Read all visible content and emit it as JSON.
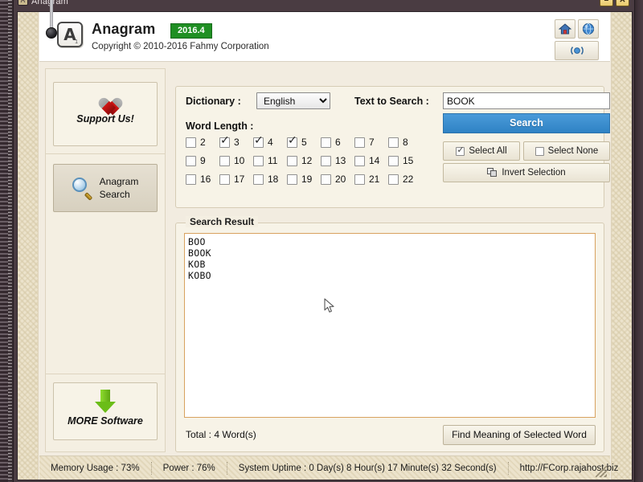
{
  "window": {
    "title": "Anagram",
    "icon": "app-icon",
    "minimize_label": "–",
    "maximize_label": "✕"
  },
  "header": {
    "logo_letter": "A",
    "logo_sub": "1",
    "app_name": "Anagram",
    "version": "2016.4",
    "version_color": "#1f8f23",
    "copyright": "Copyright © 2010-2016 Fahmy Corporation",
    "icons": [
      {
        "name": "home-icon",
        "glyph": "⌂"
      },
      {
        "name": "info-globe-icon",
        "glyph": "i"
      },
      {
        "name": "update-icon",
        "glyph": "(•)"
      }
    ]
  },
  "sidebar": {
    "support": {
      "label": "Support Us!",
      "icon": "heart-icon"
    },
    "anagram": {
      "label_line1": "Anagram",
      "label_line2": "Search",
      "icon": "magnifier-icon"
    },
    "more": {
      "label": "MORE Software",
      "icon": "download-arrow-icon"
    }
  },
  "main": {
    "dictionary_label": "Dictionary :",
    "dictionary_value": "English",
    "dictionary_options": [
      "English"
    ],
    "text_to_search_label": "Text to Search :",
    "text_to_search_value": "BOOK",
    "search_button": "Search",
    "word_length_label": "Word Length :",
    "select_all": "Select All",
    "select_none": "Select None",
    "invert_selection": "Invert Selection",
    "word_lengths": [
      {
        "n": "2",
        "checked": false
      },
      {
        "n": "3",
        "checked": true
      },
      {
        "n": "4",
        "checked": true
      },
      {
        "n": "5",
        "checked": true
      },
      {
        "n": "6",
        "checked": false
      },
      {
        "n": "7",
        "checked": false
      },
      {
        "n": "8",
        "checked": false
      },
      {
        "n": "9",
        "checked": false
      },
      {
        "n": "10",
        "checked": false
      },
      {
        "n": "11",
        "checked": false
      },
      {
        "n": "12",
        "checked": false
      },
      {
        "n": "13",
        "checked": false
      },
      {
        "n": "14",
        "checked": false
      },
      {
        "n": "15",
        "checked": false
      },
      {
        "n": "16",
        "checked": false
      },
      {
        "n": "17",
        "checked": false
      },
      {
        "n": "18",
        "checked": false
      },
      {
        "n": "19",
        "checked": false
      },
      {
        "n": "20",
        "checked": false
      },
      {
        "n": "21",
        "checked": false
      },
      {
        "n": "22",
        "checked": false
      }
    ]
  },
  "result": {
    "group_title": "Search Result",
    "words": [
      "BOO",
      "BOOK",
      "KOB",
      "KOBO"
    ],
    "total": "Total : 4 Word(s)",
    "find_meaning_button": "Find Meaning of Selected Word",
    "border_color": "#d8a25f"
  },
  "statusbar": {
    "memory": "Memory Usage : 73%",
    "power": "Power : 76%",
    "uptime": "System Uptime : 0 Day(s) 8 Hour(s) 17 Minute(s) 32 Second(s)",
    "website": "http://FCorp.rajahost.biz"
  }
}
